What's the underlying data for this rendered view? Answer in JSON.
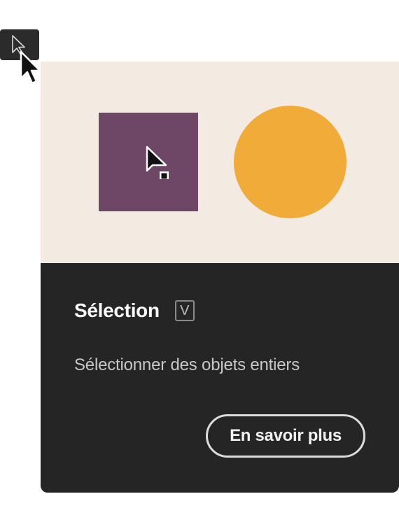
{
  "tool": {
    "name": "selection-tool",
    "icon": "selection-arrow-icon"
  },
  "tooltip": {
    "title": "Sélection",
    "shortcut": "V",
    "description": "Sélectionner des objets entiers",
    "learn_more_label": "En savoir plus"
  },
  "illustration": {
    "square_color": "#6e4766",
    "circle_color": "#f1ab38",
    "background_color": "#f3ebe2",
    "cursor_icon": "selection-cursor-icon"
  },
  "colors": {
    "panel": "#252525",
    "button": "#2b2b2b"
  }
}
